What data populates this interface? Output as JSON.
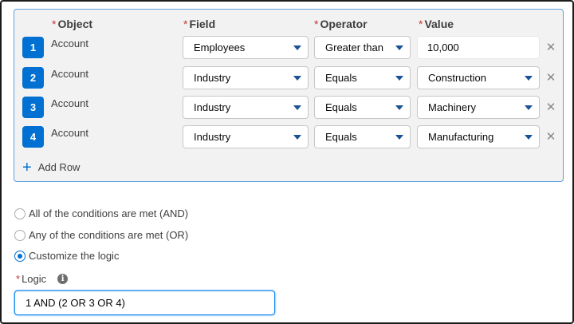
{
  "headers": {
    "object": "Object",
    "field": "Field",
    "operator": "Operator",
    "value": "Value",
    "required_mark": "*"
  },
  "rows": [
    {
      "number": "1",
      "object": "Account",
      "field": "Employees",
      "operator": "Greater than",
      "value": "10,000"
    },
    {
      "number": "2",
      "object": "Account",
      "field": "Industry",
      "operator": "Equals",
      "value": "Construction"
    },
    {
      "number": "3",
      "object": "Account",
      "field": "Industry",
      "operator": "Equals",
      "value": "Machinery"
    },
    {
      "number": "4",
      "object": "Account",
      "field": "Industry",
      "operator": "Equals",
      "value": "Manufacturing"
    }
  ],
  "delete_glyph": "✕",
  "add_row_label": "Add Row",
  "conditions": {
    "options": [
      {
        "label": "All of the conditions are met (AND)",
        "checked": false
      },
      {
        "label": "Any of the conditions are met (OR)",
        "checked": false
      },
      {
        "label": "Customize the logic",
        "checked": true
      }
    ]
  },
  "logic": {
    "label": "Logic",
    "required_mark": "*",
    "info_glyph": "i",
    "value": "1 AND (2 OR 3 OR 4)"
  },
  "colors": {
    "accent": "#0070d2",
    "required": "#c23934",
    "panel_bg": "#f3f2f2",
    "panel_border": "#5d9fe0"
  }
}
